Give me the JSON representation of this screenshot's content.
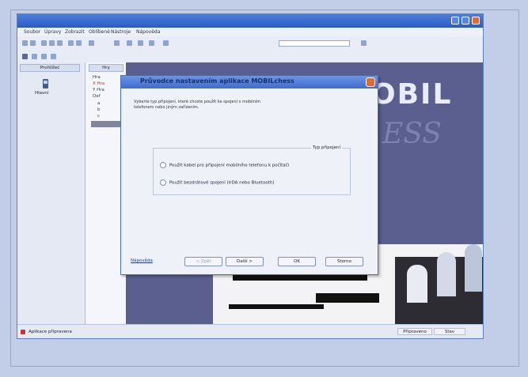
{
  "app": {
    "menu": [
      "Soubor",
      "Úpravy",
      "Zobrazit",
      "Oblíbené",
      "Nástroje",
      "Nápověda"
    ]
  },
  "left_pane": {
    "header": "Prohlížeč",
    "icon_label": "Hlavní"
  },
  "tree": {
    "header": "Hry",
    "items": [
      "Hra",
      "X Hra",
      "Y Hra",
      "Def",
      "a",
      "b",
      "c"
    ]
  },
  "status_bar": {
    "left_text": "Aplikace připravena",
    "cells": [
      "Připraveno",
      "Stav"
    ]
  },
  "banner": {
    "word": "OBIL",
    "word2": "ESS"
  },
  "dialog": {
    "title": "Průvodce nastavením aplikace MOBILchess",
    "description": "Vyberte typ připojení, které chcete použít ke spojení s mobilním telefonem nebo jiným zařízením.",
    "group_label": "Typ připojení",
    "option1": "Použít kabel pro připojení mobilního telefonu k počítači",
    "option2": "Použít bezdrátové spojení (IrDA nebo Bluetooth)",
    "link": "Nápověda",
    "buttons": [
      "< Zpět",
      "Další >",
      "OK",
      "Storno"
    ]
  }
}
